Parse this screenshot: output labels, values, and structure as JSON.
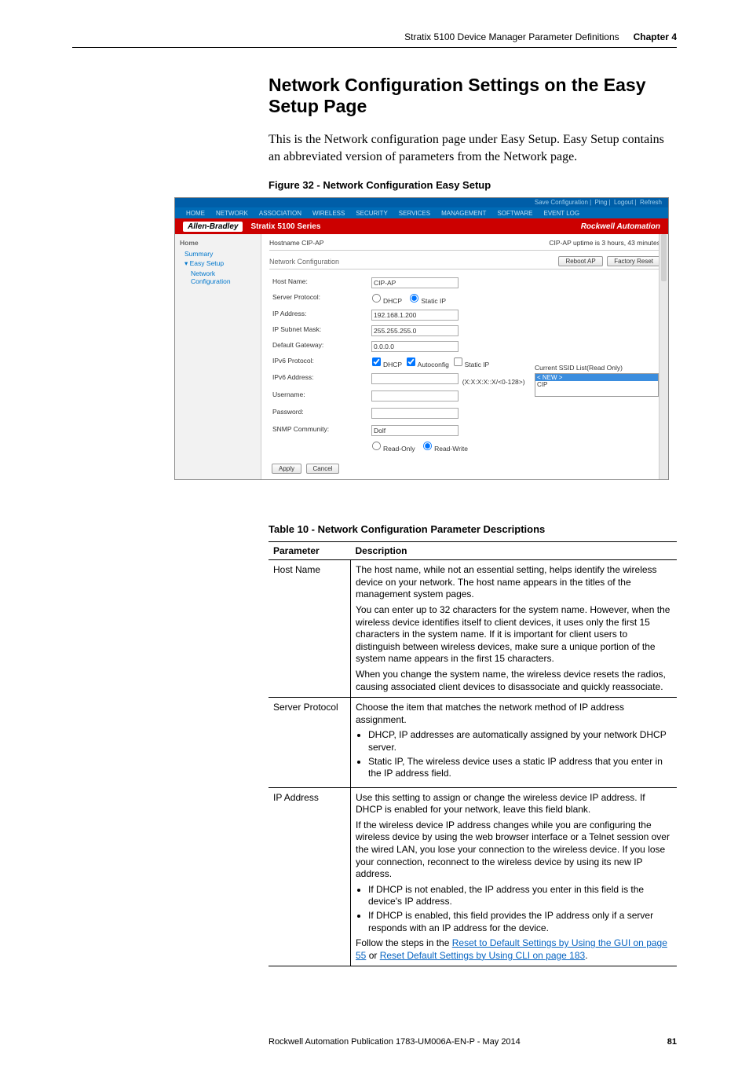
{
  "header": {
    "running_title": "Stratix 5100 Device Manager Parameter Definitions",
    "chapter": "Chapter 4"
  },
  "section_heading": "Network Configuration Settings on the Easy Setup Page",
  "intro_text": "This is the Network configuration page under Easy Setup. Easy Setup contains an abbreviated version of parameters from the Network page.",
  "figure_caption": "Figure 32 - Network Configuration Easy Setup",
  "screenshot": {
    "toplinks": {
      "save": "Save Configuration",
      "ping": "Ping",
      "logout": "Logout",
      "refresh": "Refresh"
    },
    "menu": {
      "home": "HOME",
      "network": "NETWORK",
      "association": "ASSOCIATION",
      "wireless": "WIRELESS",
      "security": "SECURITY",
      "services": "SERVICES",
      "management": "MANAGEMENT",
      "software": "SOFTWARE",
      "eventlog": "EVENT LOG"
    },
    "brand_left_icon": "Allen-Bradley",
    "brand_mid": "Stratix 5100 Series",
    "brand_right": "Rockwell Automation",
    "side": {
      "home": "Home",
      "summary": "Summary",
      "easy_setup": "Easy Setup",
      "network_config": "Network Configuration"
    },
    "hostname_label": "Hostname",
    "hostname_value": "CIP-AP",
    "uptime": "CIP-AP uptime is 3 hours, 43 minutes",
    "nc_title": "Network Configuration",
    "reboot": "Reboot AP",
    "factory_reset": "Factory Reset",
    "labels": {
      "host_name": "Host Name:",
      "server_protocol": "Server Protocol:",
      "ip_address": "IP Address:",
      "ip_subnet": "IP Subnet Mask:",
      "gateway": "Default Gateway:",
      "ipv6_protocol": "IPv6 Protocol:",
      "ipv6_address": "IPv6 Address:",
      "username": "Username:",
      "password": "Password:",
      "snmp": "SNMP Community:"
    },
    "values": {
      "host_name": "CIP-AP",
      "dhcp": "DHCP",
      "static_ip": "Static IP",
      "ip": "192.168.1.200",
      "mask": "255.255.255.0",
      "gw": "0.0.0.0",
      "autoconfig": "Autoconfig",
      "ipv6_note": "(X:X:X:X::X/<0-128>)",
      "snmp": "Dolf",
      "read_only": "Read-Only",
      "read_write": "Read-Write"
    },
    "ssid": {
      "title": "Current SSID List(Read Only)",
      "new": "< NEW >",
      "cip": "CIP"
    },
    "apply": "Apply",
    "cancel": "Cancel"
  },
  "table_caption": "Table 10 - Network Configuration Parameter Descriptions",
  "table": {
    "col_param": "Parameter",
    "col_desc": "Description",
    "rows": {
      "hostname": {
        "param": "Host Name",
        "p1": "The host name, while not an essential setting, helps identify the wireless device on your network. The host name appears in the titles of the management system pages.",
        "p2": "You can enter up to 32 characters for the system name. However, when the wireless device identifies itself to client devices, it uses only the first 15 characters in the system name. If it is important for client users to distinguish between wireless devices, make sure a unique portion of the system name appears in the first 15 characters.",
        "p3": "When you change the system name, the wireless device resets the radios, causing associated client devices to disassociate and quickly reassociate."
      },
      "serverprot": {
        "param": "Server Protocol",
        "p1": "Choose the item that matches the network method of IP address assignment.",
        "li1": "DHCP, IP addresses are automatically assigned by your network DHCP server.",
        "li2": "Static IP, The wireless device uses a static IP address that you enter in the IP address field."
      },
      "ipaddr": {
        "param": "IP Address",
        "p1": "Use this setting to assign or change the wireless device IP address. If DHCP is enabled for your network, leave this field blank.",
        "p2": "If the wireless device IP address changes while you are configuring the wireless device by using the web browser interface or a Telnet session over the wired LAN, you lose your connection to the wireless device. If you lose your connection, reconnect to the wireless device by using its new IP address.",
        "li1": "If DHCP is not enabled, the IP address you enter in this field is the device's IP address.",
        "li2": "If DHCP is enabled, this field provides the IP address only if a server responds with an IP address for the device.",
        "p3_prefix": "Follow the steps in the ",
        "link1": "Reset to Default Settings by Using the GUI on page 55",
        "p3_mid": " or ",
        "link2": "Reset Default Settings by Using CLI on page 183",
        "p3_suffix": "."
      }
    }
  },
  "footer": {
    "pub": "Rockwell Automation Publication 1783-UM006A-EN-P - May 2014",
    "page": "81"
  }
}
